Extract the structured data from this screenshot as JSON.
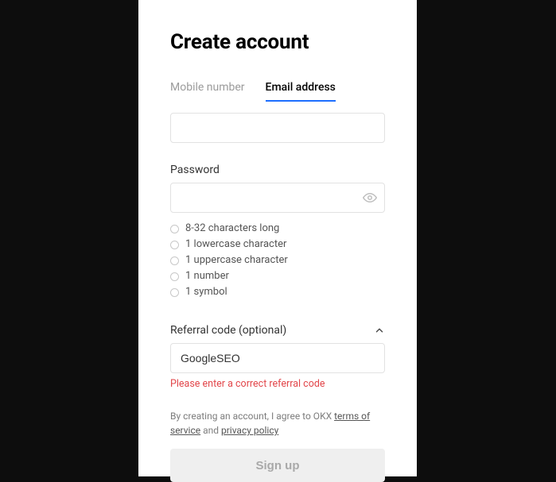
{
  "title": "Create account",
  "tabs": {
    "mobile": "Mobile number",
    "email": "Email address"
  },
  "email": {
    "value": ""
  },
  "password": {
    "label": "Password",
    "value": "",
    "rules": [
      "8-32 characters long",
      "1 lowercase character",
      "1 uppercase character",
      "1 number",
      "1 symbol"
    ]
  },
  "referral": {
    "label": "Referral code (optional)",
    "value": "GoogleSEO",
    "error": "Please enter a correct referral code"
  },
  "consent": {
    "prefix": "By creating an account, I agree to OKX ",
    "terms": "terms of service",
    "mid": " and ",
    "privacy": "privacy policy"
  },
  "button": "Sign up"
}
